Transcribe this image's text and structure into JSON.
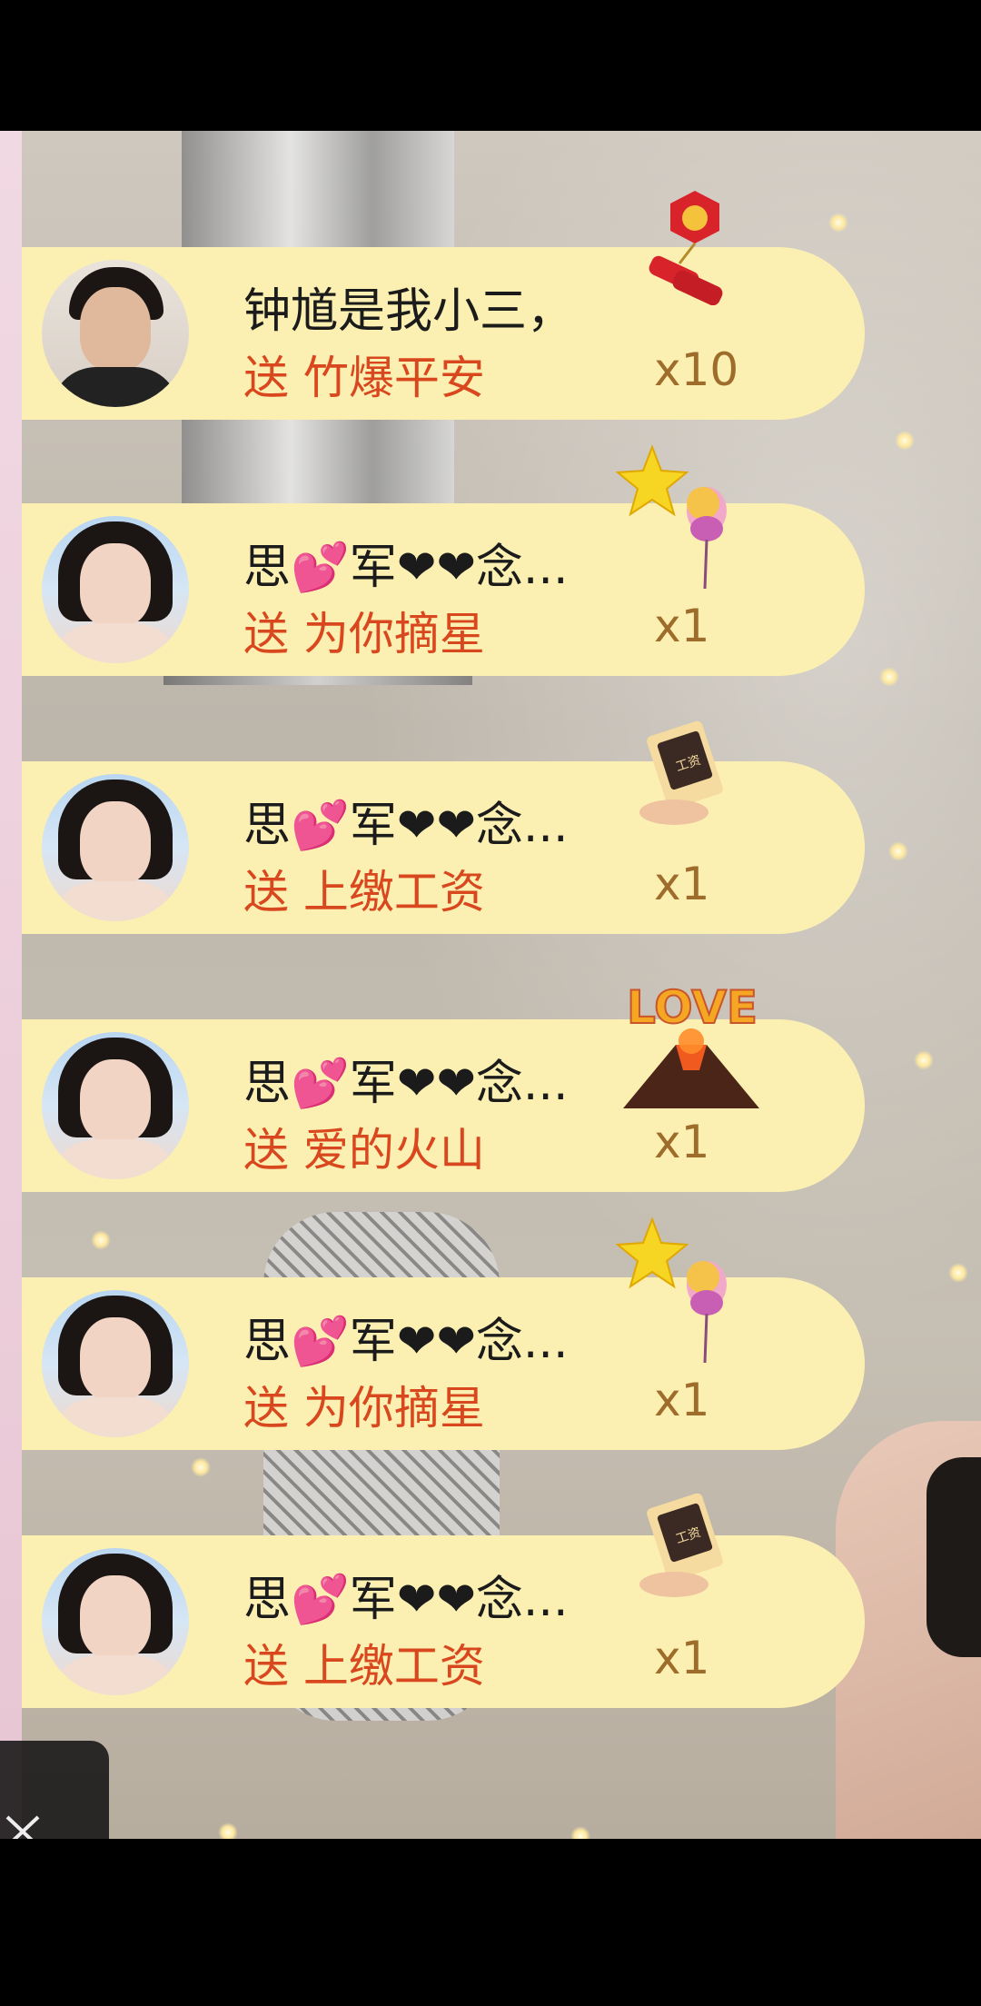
{
  "gifts": [
    {
      "user": "钟馗是我小三，",
      "verb": "送",
      "gift": "竹爆平安",
      "count": "x10",
      "icon": "firecracker-icon",
      "avatar": "male-avatar"
    },
    {
      "user": "思💕军❤❤念...",
      "verb": "送",
      "gift": "为你摘星",
      "count": "x1",
      "icon": "star-balloon-icon",
      "avatar": "female-avatar"
    },
    {
      "user": "思💕军❤❤念...",
      "verb": "送",
      "gift": "上缴工资",
      "count": "x1",
      "icon": "salary-envelope-icon",
      "avatar": "female-avatar"
    },
    {
      "user": "思💕军❤❤念...",
      "verb": "送",
      "gift": "爱的火山",
      "count": "x1",
      "icon": "love-volcano-icon",
      "avatar": "female-avatar"
    },
    {
      "user": "思💕军❤❤念...",
      "verb": "送",
      "gift": "为你摘星",
      "count": "x1",
      "icon": "star-balloon-icon",
      "avatar": "female-avatar"
    },
    {
      "user": "思💕军❤❤念...",
      "verb": "送",
      "gift": "上缴工资",
      "count": "x1",
      "icon": "salary-envelope-icon",
      "avatar": "female-avatar"
    }
  ],
  "icons": {
    "love_text": "LOVE",
    "salary_text": "工资"
  },
  "colors": {
    "row_bg": "#fbf0b2",
    "gift_name": "#d9471e",
    "username": "#1b1b1b"
  }
}
